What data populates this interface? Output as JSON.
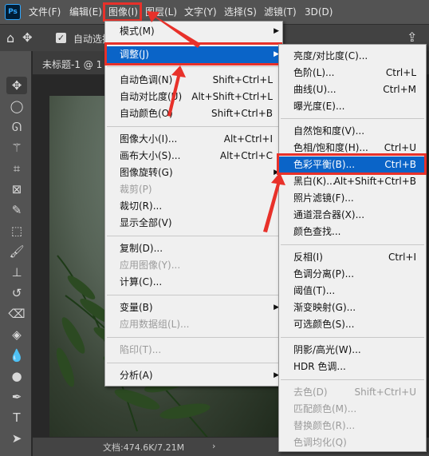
{
  "menubar": {
    "logo": "Ps",
    "items": [
      "文件(F)",
      "编辑(E)",
      "图像(I)",
      "图层(L)",
      "文字(Y)",
      "选择(S)",
      "滤镜(T)",
      "3D(D)"
    ]
  },
  "options": {
    "auto_select": "自动选择"
  },
  "tab": {
    "title": "未标题-1 @ 1"
  },
  "status": {
    "doc": "文档:474.6K/7.21M"
  },
  "image_menu": {
    "items": [
      {
        "label": "模式(M)",
        "shortcut": "",
        "submenu": true,
        "disabled": false
      },
      {
        "label": "调整(J)",
        "shortcut": "",
        "submenu": true,
        "disabled": false,
        "highlight": true
      },
      {
        "label": "自动色调(N)",
        "shortcut": "Shift+Ctrl+L",
        "disabled": false
      },
      {
        "label": "自动对比度(U)",
        "shortcut": "Alt+Shift+Ctrl+L",
        "disabled": false
      },
      {
        "label": "自动颜色(O)",
        "shortcut": "Shift+Ctrl+B",
        "disabled": false
      },
      {
        "label": "图像大小(I)...",
        "shortcut": "Alt+Ctrl+I",
        "disabled": false
      },
      {
        "label": "画布大小(S)...",
        "shortcut": "Alt+Ctrl+C",
        "disabled": false
      },
      {
        "label": "图像旋转(G)",
        "shortcut": "",
        "submenu": true,
        "disabled": false
      },
      {
        "label": "裁剪(P)",
        "shortcut": "",
        "disabled": true
      },
      {
        "label": "裁切(R)...",
        "shortcut": "",
        "disabled": false
      },
      {
        "label": "显示全部(V)",
        "shortcut": "",
        "disabled": false
      },
      {
        "label": "复制(D)...",
        "shortcut": "",
        "disabled": false
      },
      {
        "label": "应用图像(Y)...",
        "shortcut": "",
        "disabled": true
      },
      {
        "label": "计算(C)...",
        "shortcut": "",
        "disabled": false
      },
      {
        "label": "变量(B)",
        "shortcut": "",
        "submenu": true,
        "disabled": false
      },
      {
        "label": "应用数据组(L)...",
        "shortcut": "",
        "disabled": true
      },
      {
        "label": "陷印(T)...",
        "shortcut": "",
        "disabled": true
      },
      {
        "label": "分析(A)",
        "shortcut": "",
        "submenu": true,
        "disabled": false
      }
    ]
  },
  "adjust_menu": {
    "items": [
      {
        "label": "亮度/对比度(C)...",
        "shortcut": "",
        "disabled": false
      },
      {
        "label": "色阶(L)...",
        "shortcut": "Ctrl+L",
        "disabled": false
      },
      {
        "label": "曲线(U)...",
        "shortcut": "Ctrl+M",
        "disabled": false
      },
      {
        "label": "曝光度(E)...",
        "shortcut": "",
        "disabled": false
      },
      {
        "label": "自然饱和度(V)...",
        "shortcut": "",
        "disabled": false
      },
      {
        "label": "色相/饱和度(H)...",
        "shortcut": "Ctrl+U",
        "disabled": false
      },
      {
        "label": "色彩平衡(B)...",
        "shortcut": "Ctrl+B",
        "disabled": false,
        "highlight": true
      },
      {
        "label": "黑白(K)...",
        "shortcut": "Alt+Shift+Ctrl+B",
        "disabled": false
      },
      {
        "label": "照片滤镜(F)...",
        "shortcut": "",
        "disabled": false
      },
      {
        "label": "通道混合器(X)...",
        "shortcut": "",
        "disabled": false
      },
      {
        "label": "颜色查找...",
        "shortcut": "",
        "disabled": false
      },
      {
        "label": "反相(I)",
        "shortcut": "Ctrl+I",
        "disabled": false
      },
      {
        "label": "色调分离(P)...",
        "shortcut": "",
        "disabled": false
      },
      {
        "label": "阈值(T)...",
        "shortcut": "",
        "disabled": false
      },
      {
        "label": "渐变映射(G)...",
        "shortcut": "",
        "disabled": false
      },
      {
        "label": "可选颜色(S)...",
        "shortcut": "",
        "disabled": false
      },
      {
        "label": "阴影/高光(W)...",
        "shortcut": "",
        "disabled": false
      },
      {
        "label": "HDR 色调...",
        "shortcut": "",
        "disabled": false
      },
      {
        "label": "去色(D)",
        "shortcut": "Shift+Ctrl+U",
        "disabled": true
      },
      {
        "label": "匹配颜色(M)...",
        "shortcut": "",
        "disabled": true
      },
      {
        "label": "替换颜色(R)...",
        "shortcut": "",
        "disabled": true
      },
      {
        "label": "色调均化(Q)",
        "shortcut": "",
        "disabled": true
      }
    ]
  },
  "colors": {
    "highlight": "#0a64c8",
    "annotation": "#e8312a"
  }
}
